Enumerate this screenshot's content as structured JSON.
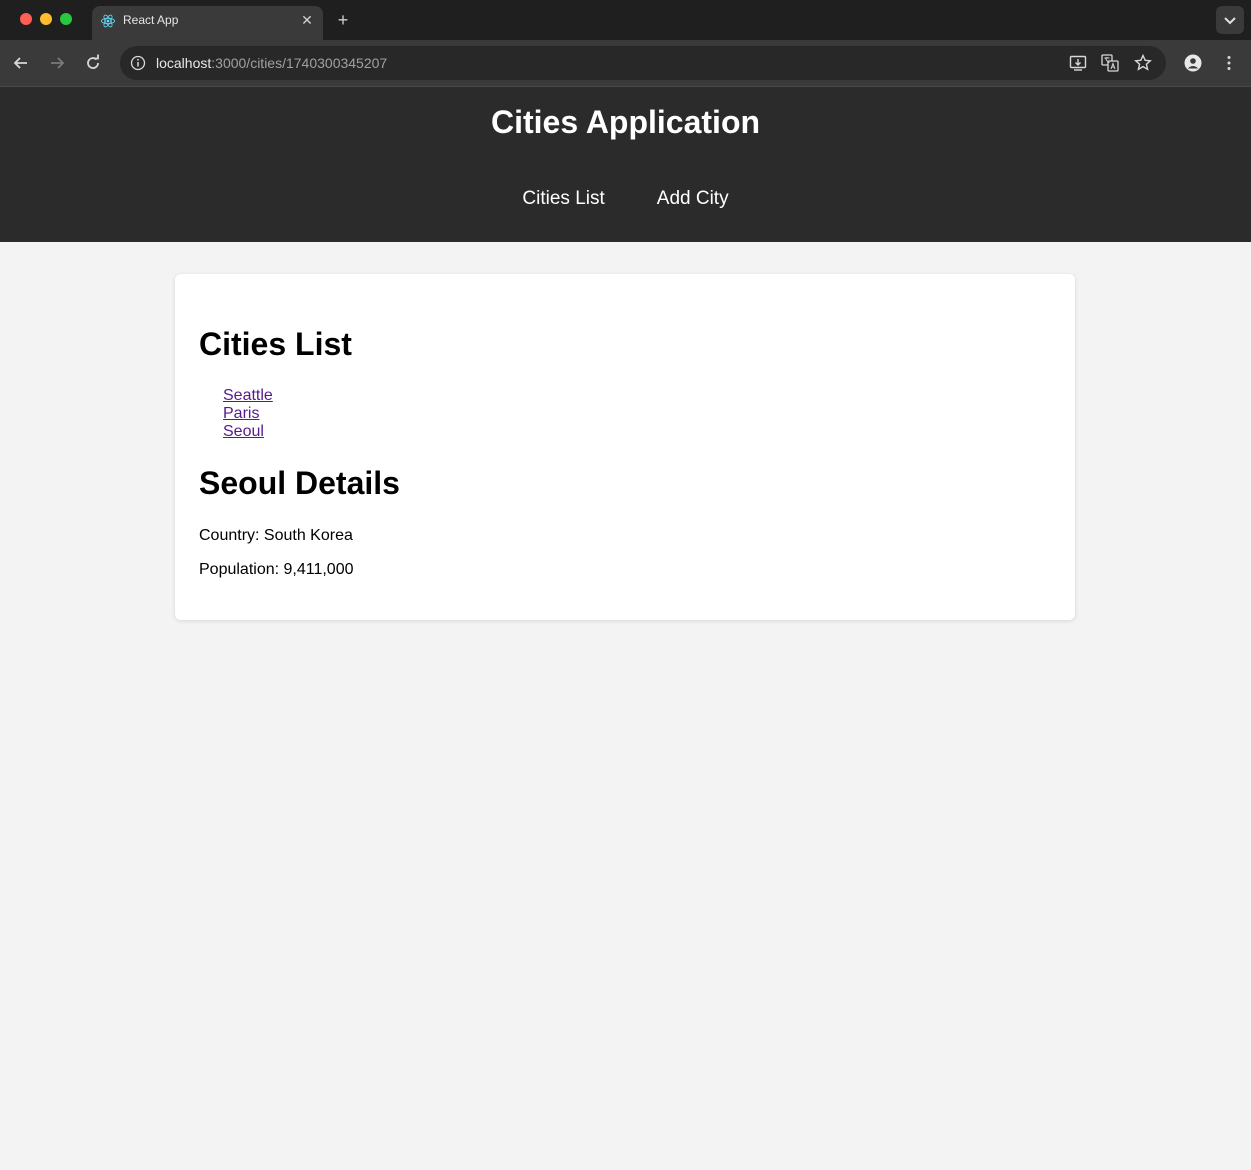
{
  "browser": {
    "tab_title": "React App",
    "url_host": "localhost",
    "url_path": ":3000/cities/1740300345207",
    "icons": {
      "favicon": "react-icon",
      "close": "close-icon",
      "new_tab": "plus-icon",
      "back": "arrow-left-icon",
      "forward": "arrow-right-icon",
      "reload": "reload-icon",
      "info": "info-icon",
      "install": "install-app-icon",
      "translate": "translate-icon",
      "bookmark": "star-icon",
      "profile": "profile-icon",
      "menu": "kebab-menu-icon"
    }
  },
  "app": {
    "title": "Cities Application",
    "nav": [
      "Cities List",
      "Add City"
    ]
  },
  "main": {
    "list_title": "Cities List",
    "cities": [
      "Seattle",
      "Paris",
      "Seoul"
    ],
    "details_title": "Seoul Details",
    "country_line": "Country: South Korea",
    "population_line": "Population: 9,411,000"
  },
  "colors": {
    "header_bg": "#2b2b2b",
    "page_bg": "#f3f3f3",
    "visited_link": "#551a8b"
  }
}
